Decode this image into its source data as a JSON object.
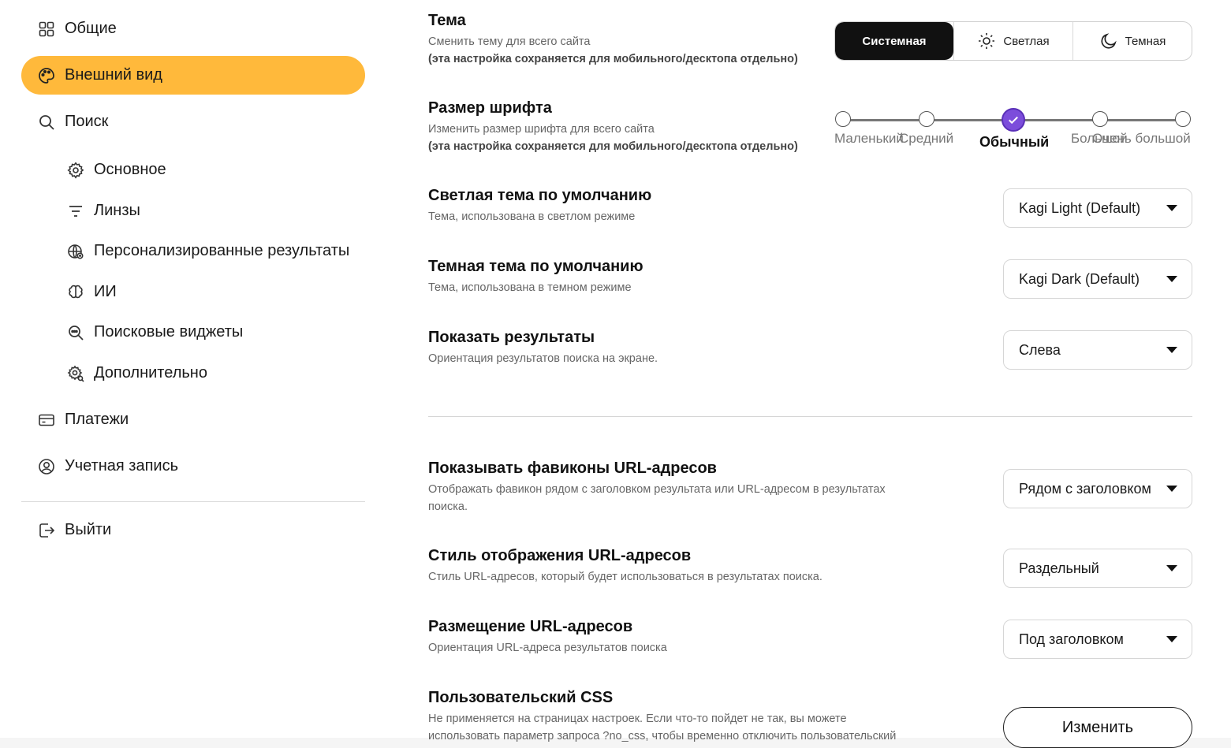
{
  "sidebar": {
    "items": [
      {
        "label": "Общие",
        "icon": "grid-icon"
      },
      {
        "label": "Внешний вид",
        "icon": "palette-icon",
        "active": true
      },
      {
        "label": "Поиск",
        "icon": "search-icon"
      },
      {
        "label": "Основное",
        "icon": "gear-icon"
      },
      {
        "label": "Линзы",
        "icon": "filter-icon"
      },
      {
        "label": "Персонализированные результаты",
        "icon": "globe-icon"
      },
      {
        "label": "ИИ",
        "icon": "brain-icon"
      },
      {
        "label": "Поисковые виджеты",
        "icon": "search-widget-icon"
      },
      {
        "label": "Дополнительно",
        "icon": "advanced-gear-icon"
      },
      {
        "label": "Платежи",
        "icon": "card-icon"
      },
      {
        "label": "Учетная запись",
        "icon": "user-circle-icon"
      },
      {
        "label": "Выйти",
        "icon": "logout-icon"
      }
    ]
  },
  "theme": {
    "title": "Тема",
    "desc": "Сменить тему для всего сайта",
    "note": "(эта настройка сохраняется для мобильного/десктопа отдельно)",
    "options": [
      "Системная",
      "Светлая",
      "Темная"
    ],
    "selected": "Системная"
  },
  "font_size": {
    "title": "Размер шрифта",
    "desc": "Изменить размер шрифта для всего сайта",
    "note": "(эта настройка сохраняется для мобильного/десктопа отдельно)",
    "options": [
      "Маленький",
      "Средний",
      "Обычный",
      "Большой",
      "Очень большой"
    ],
    "selected": "Обычный"
  },
  "light_default": {
    "title": "Светлая тема по умолчанию",
    "desc": "Тема, использована в светлом режиме",
    "value": "Kagi Light (Default)"
  },
  "dark_default": {
    "title": "Темная тема по умолчанию",
    "desc": "Тема, использована в темном режиме",
    "value": "Kagi Dark (Default)"
  },
  "results": {
    "title": "Показать результаты",
    "desc": "Ориентация результатов поиска на экране.",
    "value": "Слева"
  },
  "favicons": {
    "title": "Показывать фавиконы URL-адресов",
    "desc": "Отображать фавикон рядом с заголовком результата или URL-адресом в результатах поиска.",
    "value": "Рядом с заголовком"
  },
  "url_style": {
    "title": "Стиль отображения URL-адресов",
    "desc": "Стиль URL-адресов, который будет использоваться в результатах поиска.",
    "value": "Раздельный"
  },
  "url_place": {
    "title": "Размещение URL-адресов",
    "desc": "Ориентация URL-адреса результатов поиска",
    "value": "Под заголовком"
  },
  "custom_css": {
    "title": "Пользовательский CSS",
    "desc": "Не применяется на страницах настроек. Если что-то пойдет не так, вы можете использовать параметр запроса ?no_css, чтобы временно отключить пользовательский",
    "button": "Изменить"
  },
  "colors": {
    "accent": "#ffb93b",
    "slider_active": "#7c4ddb",
    "segment_active": "#111111"
  }
}
